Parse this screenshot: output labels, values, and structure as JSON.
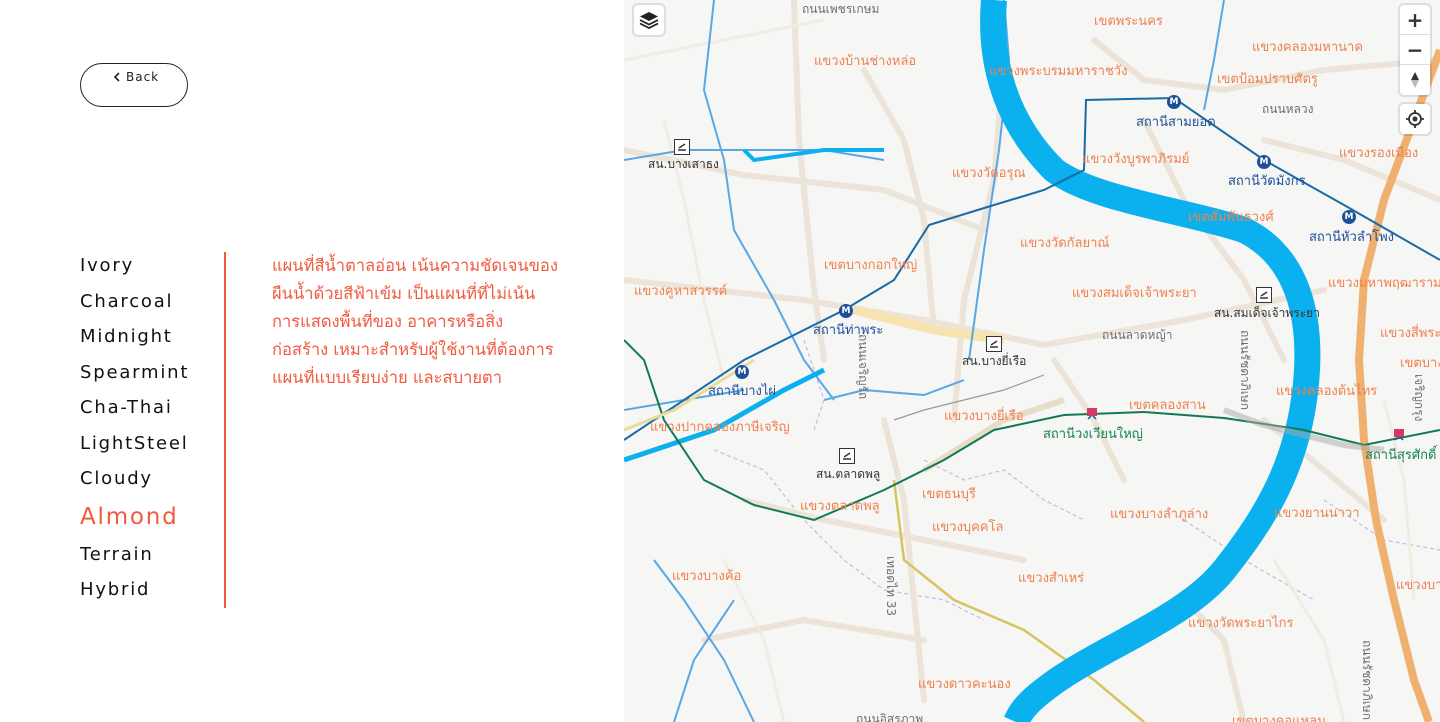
{
  "back_button": {
    "label": "Back"
  },
  "styles": [
    {
      "label": "Ivory",
      "active": false
    },
    {
      "label": "Charcoal",
      "active": false
    },
    {
      "label": "Midnight",
      "active": false
    },
    {
      "label": "Spearmint",
      "active": false
    },
    {
      "label": "Cha-Thai",
      "active": false
    },
    {
      "label": "LightSteel",
      "active": false
    },
    {
      "label": "Cloudy",
      "active": false
    },
    {
      "label": "Almond",
      "active": true
    },
    {
      "label": "Terrain",
      "active": false
    },
    {
      "label": "Hybrid",
      "active": false
    }
  ],
  "description": {
    "lines": [
      "แผนที่สีน้ำตาลอ่อน เน้นความชัดเจนของ",
      "ผืนน้ำด้วยสีฟ้าเข้ม เป็นแผนที่ที่ไม่เน้น",
      "การแสดงพื้นที่ของ อาคารหรือสิ่ง",
      "ก่อสร้าง เหมาะสำหรับผู้ใช้งานที่ต้องการ",
      "แผนที่แบบเรียบง่าย และสบายตา"
    ]
  },
  "colors": {
    "accent": "#f15a3f",
    "water": "#0bb1ee",
    "metro_line": "#1a6aa5",
    "rail_line": "#117a55",
    "district_label": "#f0804f"
  },
  "map_controls": {
    "layers_icon": "layers-icon",
    "zoom_in": "+",
    "zoom_out": "−",
    "compass_icon": "compass-icon",
    "locate_icon": "locate-icon"
  },
  "map_labels": {
    "districts": [
      "เขตพระนคร",
      "แขวงคลองมหานาค",
      "แขวงบ้านช่างหล่อ",
      "แขวงพระบรมมหาราชวัง",
      "เขตป้อมปราบศัตรู",
      "แขวงวัดอรุณ",
      "แขวงวังบูรพาภิรมย์",
      "แขวงรองเมือง",
      "เขตสัมพันธวงศ์",
      "แขวงวัดกัลยาณ์",
      "เขตบางกอกใหญ่",
      "แขวงคูหาสวรรค์",
      "แขวงสมเด็จเจ้าพระยา",
      "แขวงมหาพฤฒาราม",
      "แขวงสี่พระยา",
      "เขตบาง",
      "แขวงบางยี่เรือ",
      "เขตคลองสาน",
      "แขวงคลองต้นไทร",
      "แขวงปากคลองภาษีเจริญ",
      "เขตธนบุรี",
      "แขวงตลาดพลู",
      "แขวงบุคคโล",
      "แขวงบางลำภูล่าง",
      "แขวงยานนาวา",
      "แขวงบางค้อ",
      "แขวงสำเหร่",
      "แขวงบาง",
      "แขวงวัดพระยาไกร",
      "แขวงดาวคะนอง",
      "เขตบางคอแหลม"
    ],
    "stations": [
      "สถานีสามยอด",
      "สถานีวัดมังกร",
      "สถานีหัวลำโพง",
      "สถานีท่าพระ",
      "สถานีบางไผ่"
    ],
    "rail_stations": [
      "สถานีวงเวียนใหญ่",
      "สถานีสุรศักดิ์"
    ],
    "piers": [
      "สน.บางเสาธง",
      "สน.สมเด็จเจ้าพระยา",
      "สน.บางยี่เรือ",
      "สน.ตลาดพลู"
    ],
    "roads": [
      "ถนนเพชรเกษม",
      "ถนนหลวง",
      "ถนนลาดหญ้า",
      "ถนนเจริญรัถ",
      "ถนนรัชดาภิเษก",
      "ถนนรัชดาภิเษก",
      "เจริญกรุง",
      "เทอดไท 33",
      "ถนนอิสรภาพ"
    ]
  }
}
